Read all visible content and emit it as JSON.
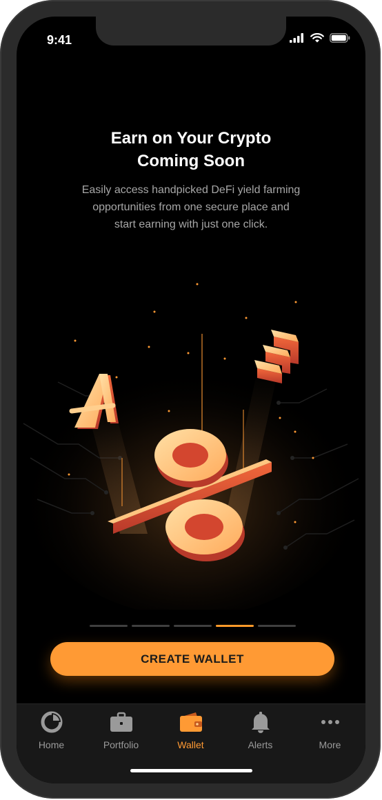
{
  "status": {
    "time": "9:41"
  },
  "hero": {
    "title_line1": "Earn on Your Crypto",
    "title_line2": "Coming Soon",
    "desc_line1": "Easily access handpicked DeFi yield farming",
    "desc_line2": "opportunities from one secure place and",
    "desc_line3": "start earning with just one click."
  },
  "pager": {
    "count": 5,
    "active_index": 3
  },
  "cta": {
    "label": "CREATE WALLET"
  },
  "tabs": [
    {
      "label": "Home",
      "icon": "pie-chart-icon",
      "active": false
    },
    {
      "label": "Portfolio",
      "icon": "briefcase-icon",
      "active": false
    },
    {
      "label": "Wallet",
      "icon": "wallet-icon",
      "active": true
    },
    {
      "label": "Alerts",
      "icon": "bell-icon",
      "active": false
    },
    {
      "label": "More",
      "icon": "more-dots-icon",
      "active": false
    }
  ],
  "colors": {
    "accent": "#ff9a34",
    "background": "#000000",
    "tabbar": "#181818",
    "inactive": "#9a9a9a"
  }
}
